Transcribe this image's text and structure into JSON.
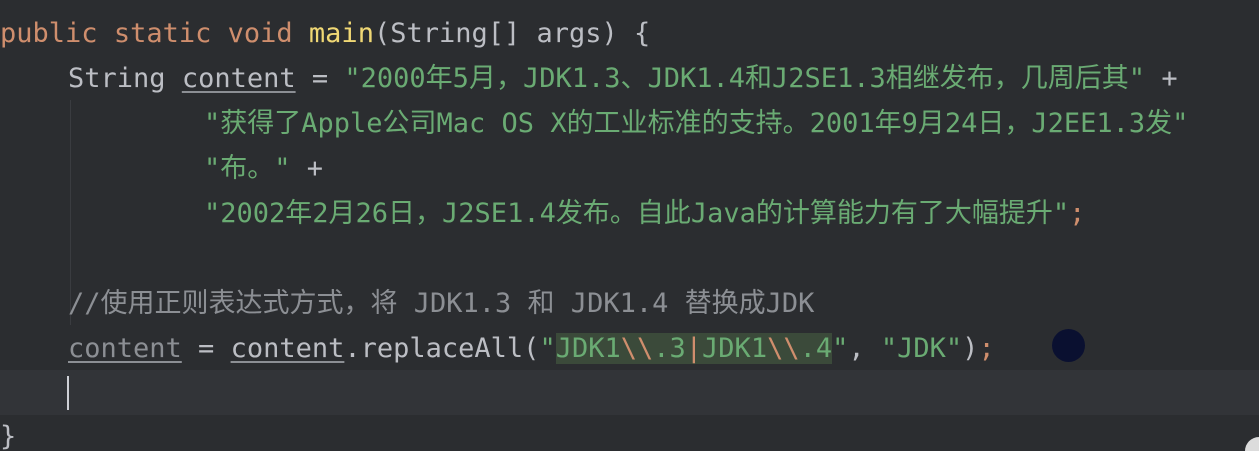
{
  "editor": {
    "line1": {
      "kw_public": "public",
      "kw_static": "static",
      "kw_void": "void",
      "method": "main",
      "params": "(String[] args) {"
    },
    "line2": {
      "type": "String",
      "var": "content",
      "assign": "=",
      "str": "\"2000年5月，JDK1.3、JDK1.4和J2SE1.3相继发布，几周后其\"",
      "plus": "+"
    },
    "line3": {
      "str": "\"获得了Apple公司Mac OS X的工业标准的支持。2001年9月24日，J2EE1.3发\""
    },
    "line4": {
      "str": "\"布。\"",
      "plus": "+"
    },
    "line5": {
      "str": "\"2002年2月26日，J2SE1.4发布。自此Java的计算能力有了大幅提升\"",
      "semi": ";"
    },
    "line7": {
      "comment": "//使用正则表达式方式，将 JDK1.3 和 JDK1.4 替换成JDK"
    },
    "line8": {
      "var": "content",
      "assign": " = ",
      "obj": "content",
      "call": ".replaceAll(",
      "q1": "\"",
      "r1": "JDK1",
      "r2": "\\\\",
      "r3": ".3",
      "r4": "|",
      "r5": "JDK1",
      "r6": "\\\\",
      "r7": ".4",
      "q2": "\"",
      "comma": ", ",
      "arg2": "\"JDK\"",
      "close": ")",
      "semi": ";"
    },
    "line10": {
      "brace": "}"
    }
  },
  "colors": {
    "background": "#2b2d30",
    "keyword": "#cf8e6d",
    "string": "#6aab73",
    "method": "#f0d875",
    "comment": "#8c8f94",
    "text": "#bcbec4"
  }
}
